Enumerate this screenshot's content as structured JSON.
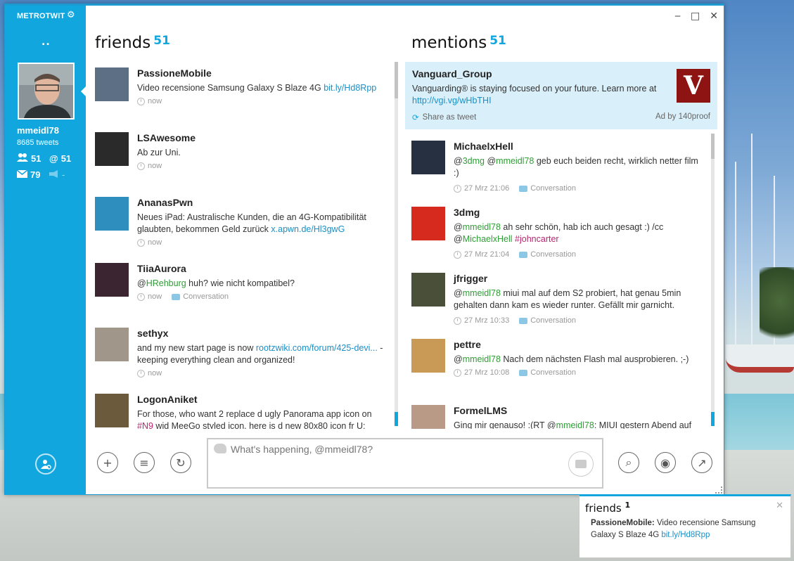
{
  "app": {
    "name": "METROTWIT",
    "settings_icon": "gear-icon"
  },
  "window_controls": {
    "minimize": "‒",
    "maximize": "□",
    "close": "✕"
  },
  "sidebar": {
    "nav_dots": "..",
    "username": "mmeidl78",
    "tweet_count": "8685 tweets",
    "friends_count": "51",
    "mentions_count": "51",
    "messages_count": "79",
    "lists_count": "-"
  },
  "friends": {
    "title": "friends",
    "count": "51",
    "tweets": [
      {
        "name": "PassioneMobile",
        "text_parts": [
          {
            "t": "Video recensione Samsung Galaxy S Blaze 4G ",
            "c": ""
          },
          {
            "t": "bit.ly/Hd8Rpp",
            "c": "link"
          }
        ],
        "time": "now",
        "conversation": ""
      },
      {
        "name": "LSAwesome",
        "text_parts": [
          {
            "t": "Ab zur Uni.",
            "c": ""
          }
        ],
        "time": "now",
        "conversation": ""
      },
      {
        "name": "AnanasPwn",
        "text_parts": [
          {
            "t": "Neues iPad: Australische Kunden, die an 4G-Kompatibilität glaubten, bekommen Geld zurück ",
            "c": ""
          },
          {
            "t": "x.apwn.de/Hl3gwG",
            "c": "link"
          }
        ],
        "time": "now",
        "conversation": ""
      },
      {
        "name": "TiiaAurora",
        "text_parts": [
          {
            "t": "@",
            "c": ""
          },
          {
            "t": "HRehburg",
            "c": "mention"
          },
          {
            "t": " huh? wie nicht kompatibel?",
            "c": ""
          }
        ],
        "time": "now",
        "conversation": "Conversation"
      },
      {
        "name": "sethyx",
        "text_parts": [
          {
            "t": "and my new start page is now ",
            "c": ""
          },
          {
            "t": "rootzwiki.com/forum/425-devi...",
            "c": "link"
          },
          {
            "t": " - keeping everything clean and organized!",
            "c": ""
          }
        ],
        "time": "now",
        "conversation": ""
      },
      {
        "name": "LogonAniket",
        "text_parts": [
          {
            "t": "For those, who want 2 replace d ugly Panorama app icon on ",
            "c": ""
          },
          {
            "t": "#N9",
            "c": "hashtag"
          },
          {
            "t": " wid MeeGo styled icon, here is d new 80x80 icon fr U:",
            "c": ""
          }
        ],
        "time": "",
        "conversation": ""
      }
    ]
  },
  "mentions": {
    "title": "mentions",
    "count": "51",
    "ad": {
      "name": "Vanguard_Group",
      "text": "Vanguarding® is staying focused on your future. Learn more at ",
      "link": "http://vgi.vg/wHbTHI",
      "share": "Share as tweet",
      "ad_by": "Ad by 140proof",
      "logo_letter": "V"
    },
    "tweets": [
      {
        "name": "MichaelxHell",
        "text_parts": [
          {
            "t": "@",
            "c": ""
          },
          {
            "t": "3dmg",
            "c": "mention"
          },
          {
            "t": " @",
            "c": ""
          },
          {
            "t": "mmeidl78",
            "c": "mention"
          },
          {
            "t": " geb euch beiden recht, wirklich netter film :)",
            "c": ""
          }
        ],
        "time": "27 Mrz 21:06",
        "conversation": "Conversation"
      },
      {
        "name": "3dmg",
        "text_parts": [
          {
            "t": "@",
            "c": ""
          },
          {
            "t": "mmeidl78",
            "c": "mention"
          },
          {
            "t": " ah sehr schön, hab ich auch gesagt :) /cc @",
            "c": ""
          },
          {
            "t": "MichaelxHell",
            "c": "mention"
          },
          {
            "t": " ",
            "c": ""
          },
          {
            "t": "#johncarter",
            "c": "hashtag"
          }
        ],
        "time": "27 Mrz 21:04",
        "conversation": "Conversation"
      },
      {
        "name": "jfrigger",
        "text_parts": [
          {
            "t": "@",
            "c": ""
          },
          {
            "t": "mmeidl78",
            "c": "mention"
          },
          {
            "t": " miui mal auf dem S2 probiert, hat genau 5min gehalten dann kam es wieder runter. Gefällt mir garnicht.",
            "c": ""
          }
        ],
        "time": "27 Mrz 10:33",
        "conversation": "Conversation"
      },
      {
        "name": "pettre",
        "text_parts": [
          {
            "t": "@",
            "c": ""
          },
          {
            "t": "mmeidl78",
            "c": "mention"
          },
          {
            "t": " Nach dem nächsten Flash mal ausprobieren. ;-)",
            "c": ""
          }
        ],
        "time": "27 Mrz 10:08",
        "conversation": "Conversation"
      },
      {
        "name": "FormelLMS",
        "text_parts": [
          {
            "t": "Ging mir genauso! :(RT @",
            "c": ""
          },
          {
            "t": "mmeidl78",
            "c": "mention"
          },
          {
            "t": ": MIUI gestern Abend auf",
            "c": ""
          }
        ],
        "time": "",
        "conversation": ""
      }
    ]
  },
  "composer": {
    "placeholder": "What's happening, @mmeidl78?"
  },
  "toolbar": {
    "left": [
      {
        "icon": "plus-icon",
        "glyph": "+"
      },
      {
        "icon": "list-icon",
        "glyph": "≡"
      },
      {
        "icon": "refresh-icon",
        "glyph": "↻"
      }
    ],
    "right": [
      {
        "icon": "search-icon",
        "glyph": "⌕"
      },
      {
        "icon": "user-icon",
        "glyph": "◉"
      },
      {
        "icon": "trending-icon",
        "glyph": "↗"
      }
    ]
  },
  "notification": {
    "title": "friends",
    "count": "1",
    "author": "PassioneMobile:",
    "text": " Video recensione Samsung Galaxy S Blaze 4G ",
    "link": "bit.ly/Hd8Rpp",
    "close": "✕"
  },
  "colors": {
    "accent": "#12a6df",
    "link": "#1a8fc6",
    "mention": "#2e9e34",
    "hashtag": "#b5266f"
  }
}
